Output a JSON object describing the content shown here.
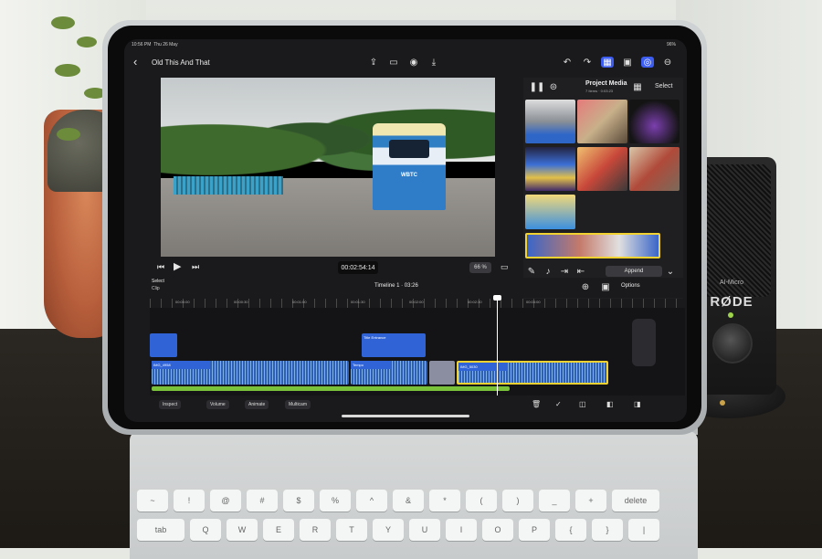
{
  "status": {
    "time": "10:56 PM",
    "date": "Thu 26 May",
    "battery": "96%"
  },
  "project": {
    "back_icon": "chevron-left-icon",
    "title": "Old This And That"
  },
  "viewer": {
    "tram_sign": "WBTC",
    "timecode": "00:02:54:14",
    "zoom": "66 %"
  },
  "browser": {
    "title": "Project Media",
    "subtitle": "7 Items · 0:03:23",
    "select_label": "Select",
    "append_label": "Append"
  },
  "timeline": {
    "select_label": "Select",
    "clip_label": "Clip",
    "title": "Timeline 1 · 03:26",
    "options_label": "Options",
    "ruler": [
      "00:00:00",
      "00:00:30",
      "00:01:00",
      "00:01:30",
      "00:02:00",
      "00:02:30",
      "00:03:00"
    ],
    "clips": {
      "upper": "Title Entrance",
      "main1": "IMG_4958",
      "main2": "Tempo",
      "main3": "IMG_5030"
    }
  },
  "bottom_bar": {
    "inspect": "Inspect",
    "volume": "Volume",
    "animate": "Animate",
    "multicam": "Multicam"
  },
  "mic": {
    "brand": "RØDE",
    "sub": "AI-Micro"
  },
  "keyboard": {
    "row1": [
      "~",
      "!",
      "@",
      "#",
      "$",
      "%",
      "^",
      "&",
      "*",
      "(",
      ")",
      "_",
      "+",
      "delete"
    ],
    "row2": [
      "tab",
      "Q",
      "W",
      "E",
      "R",
      "T",
      "Y",
      "U",
      "I",
      "O",
      "P",
      "{",
      "}",
      "|"
    ]
  }
}
